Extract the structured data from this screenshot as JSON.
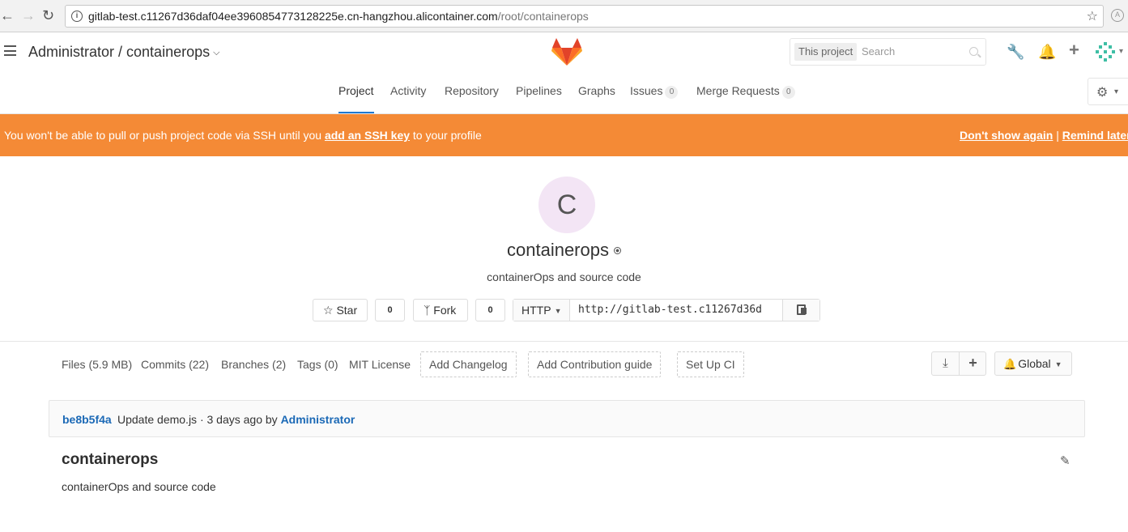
{
  "browser": {
    "url_host": "gitlab-test.c11267d36daf04ee3960854773128225e.cn-hangzhou.alicontainer.com",
    "url_path": "/root/containerops"
  },
  "header": {
    "title": "Administrator / containerops",
    "search_scope": "This project",
    "search_placeholder": "Search",
    "logo_colors": [
      "#e24329",
      "#fc6d26",
      "#fca326"
    ]
  },
  "nav": {
    "tabs": [
      {
        "label": "Project",
        "active": true
      },
      {
        "label": "Activity"
      },
      {
        "label": "Repository"
      },
      {
        "label": "Pipelines"
      },
      {
        "label": "Graphs"
      },
      {
        "label": "Issues",
        "count": "0"
      },
      {
        "label": "Merge Requests",
        "count": "0"
      }
    ]
  },
  "banner": {
    "color": "#f48a36",
    "prefix": "You won't be able to pull or push project code via SSH until you",
    "link": "add an SSH key",
    "suffix": "to your profile",
    "dont_show": "Don't show again",
    "separator": "|",
    "remind": "Remind later"
  },
  "project": {
    "avatar_letter": "C",
    "name": "containerops",
    "description": "containerOps and source code",
    "star_label": "Star",
    "star_count": "0",
    "fork_label": "Fork",
    "fork_count": "0",
    "protocol": "HTTP",
    "clone_url": "http://gitlab-test.c11267d36d"
  },
  "stats": {
    "files": "Files (5.9 MB)",
    "commits": "Commits (22)",
    "branches": "Branches (2)",
    "tags": "Tags (0)",
    "license": "MIT License",
    "add_changelog": "Add Changelog",
    "add_contribution": "Add Contribution guide",
    "setup_ci": "Set Up CI",
    "notification": "Global"
  },
  "commit": {
    "sha": "be8b5f4a",
    "message": "Update demo.js · 3 days ago by",
    "author": "Administrator"
  },
  "readme": {
    "title": "containerops",
    "body": "containerOps and source code"
  }
}
